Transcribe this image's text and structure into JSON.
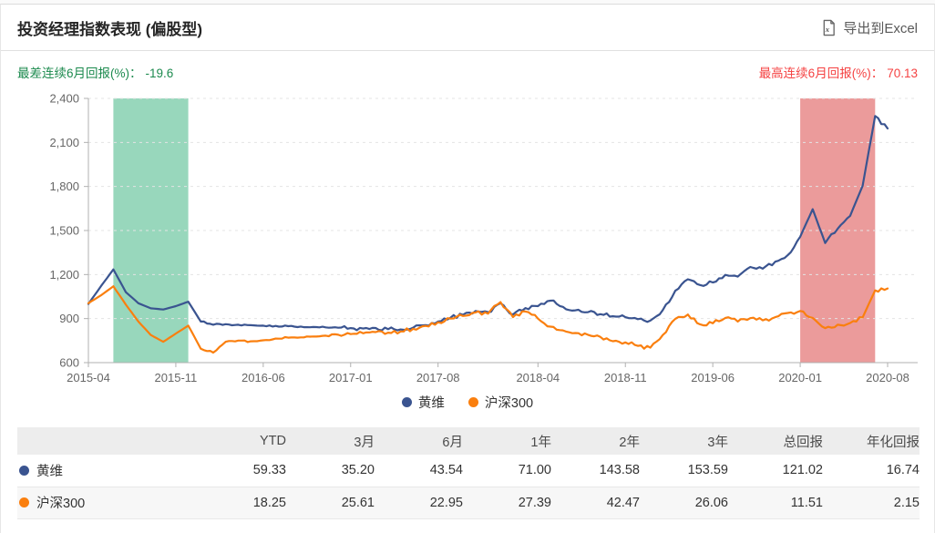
{
  "header": {
    "title": "投资经理指数表现 (偏股型)",
    "export_label": "导出到Excel"
  },
  "annotations": {
    "worst": {
      "label": "最差连续6月回报(%)：",
      "value": "-19.6",
      "text_color": "#1c8a4e"
    },
    "best": {
      "label": "最高连续6月回报(%)：",
      "value": "70.13",
      "text_color": "#f54242"
    }
  },
  "colors": {
    "series_huangwei": "#3a5490",
    "series_hs300": "#fa7f0e",
    "worst_band": "#98d7bc",
    "best_band": "#eb9b9b",
    "grid": "#e4e4e4",
    "axis": "#b0b0b0",
    "tick_text": "#666666"
  },
  "chart_data": {
    "type": "line",
    "title": "投资经理指数表现 (偏股型)",
    "x_freq": "monthly",
    "x_start": "2015-04",
    "x_end": "2020-08",
    "n_points": 65,
    "x_tick_labels": [
      "2015-04",
      "2015-11",
      "2016-06",
      "2017-01",
      "2017-08",
      "2018-04",
      "2018-11",
      "2019-06",
      "2020-01",
      "2020-08"
    ],
    "x_tick_indices": [
      0,
      7,
      14,
      21,
      28,
      36,
      43,
      50,
      57,
      64
    ],
    "ylim": [
      600,
      2400
    ],
    "y_ticks": [
      600,
      900,
      1200,
      1500,
      1800,
      2100,
      2400
    ],
    "y_tick_labels": [
      "600",
      "900",
      "1,200",
      "1,500",
      "1,800",
      "2,100",
      "2,400"
    ],
    "grid": "horizontal dashed",
    "legend_position": "bottom-center",
    "bands": [
      {
        "name": "worst-6m-band",
        "from": "2015-06",
        "to": "2015-12",
        "from_index": 2,
        "to_index": 8,
        "color": "#98d7bc"
      },
      {
        "name": "best-6m-band",
        "from": "2020-01",
        "to": "2020-07",
        "from_index": 57,
        "to_index": 63,
        "color": "#eb9b9b"
      }
    ],
    "series": [
      {
        "name": "黄维",
        "color": "#3a5490",
        "values": [
          1000,
          1120,
          1235,
          1080,
          1005,
          970,
          962,
          985,
          1015,
          880,
          858,
          862,
          858,
          855,
          852,
          850,
          848,
          846,
          843,
          840,
          838,
          835,
          832,
          836,
          828,
          826,
          838,
          856,
          880,
          906,
          926,
          952,
          944,
          1005,
          928,
          972,
          985,
          1022,
          980,
          956,
          944,
          930,
          916,
          910,
          896,
          886,
          958,
          1090,
          1168,
          1128,
          1146,
          1198,
          1186,
          1252,
          1240,
          1288,
          1332,
          1458,
          1645,
          1415,
          1512,
          1600,
          1805,
          2280,
          2195
        ]
      },
      {
        "name": "沪深300",
        "color": "#fa7f0e",
        "values": [
          1005,
          1058,
          1120,
          995,
          880,
          788,
          742,
          798,
          852,
          695,
          668,
          742,
          750,
          745,
          752,
          764,
          770,
          772,
          778,
          784,
          790,
          794,
          800,
          808,
          804,
          812,
          830,
          850,
          875,
          900,
          918,
          942,
          933,
          1012,
          910,
          948,
          900,
          845,
          820,
          802,
          790,
          775,
          746,
          738,
          714,
          702,
          788,
          898,
          928,
          860,
          868,
          904,
          880,
          903,
          888,
          910,
          938,
          952,
          905,
          835,
          858,
          870,
          908,
          1092,
          1105
        ]
      }
    ]
  },
  "legend": {
    "items": [
      {
        "label": "黄维",
        "color": "#3a5490"
      },
      {
        "label": "沪深300",
        "color": "#fa7f0e"
      }
    ]
  },
  "table": {
    "columns": [
      "YTD",
      "3月",
      "6月",
      "1年",
      "2年",
      "3年",
      "总回报",
      "年化回报"
    ],
    "rows": [
      {
        "name": "黄维",
        "color": "#3a5490",
        "values": [
          "59.33",
          "35.20",
          "43.54",
          "71.00",
          "143.58",
          "153.59",
          "121.02",
          "16.74"
        ]
      },
      {
        "name": "沪深300",
        "color": "#fa7f0e",
        "values": [
          "18.25",
          "25.61",
          "22.95",
          "27.39",
          "42.47",
          "26.06",
          "11.51",
          "2.15"
        ]
      }
    ]
  }
}
